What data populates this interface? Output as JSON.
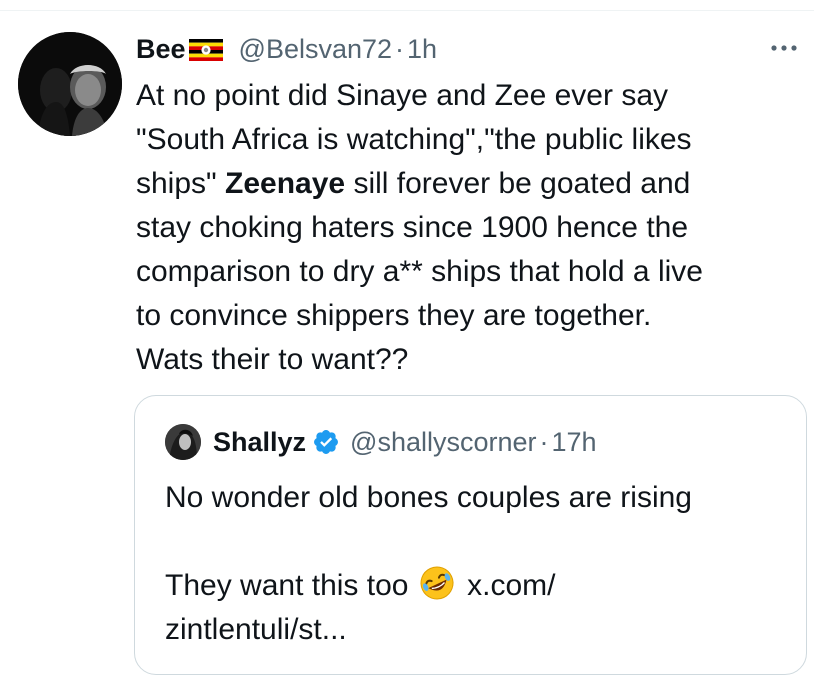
{
  "tweet": {
    "author": {
      "display_name": "Bee",
      "flag_icon": "uganda-flag-icon",
      "handle": "@Belsvan72",
      "separator": "·",
      "time": "1h"
    },
    "text_lines": [
      "At no point did Sinaye and Zee ever say",
      "\"South Africa is watching\",\"the public likes",
      "ships\" ",
      "Zeenaye",
      " sill forever be goated and",
      "stay choking haters since 1900 hence the",
      "comparison to dry a** ships that hold a live",
      "to convince shippers they are together.",
      "Wats their to want??"
    ],
    "more_icon": "more-options-icon"
  },
  "quote": {
    "author": {
      "display_name": "Shallyz",
      "verified_icon": "verified-badge-icon",
      "handle": "@shallyscorner",
      "separator": "·",
      "time": "17h"
    },
    "text_lines": [
      "No wonder old bones couples are rising",
      "They want this too ",
      " x.com/",
      "zintlentuli/st..."
    ],
    "emoji": "rolling-on-floor-laughing-emoji"
  },
  "colors": {
    "text_primary": "#0f1419",
    "text_secondary": "#536471",
    "border": "#cfd9de",
    "verified_blue": "#1d9bf0"
  }
}
